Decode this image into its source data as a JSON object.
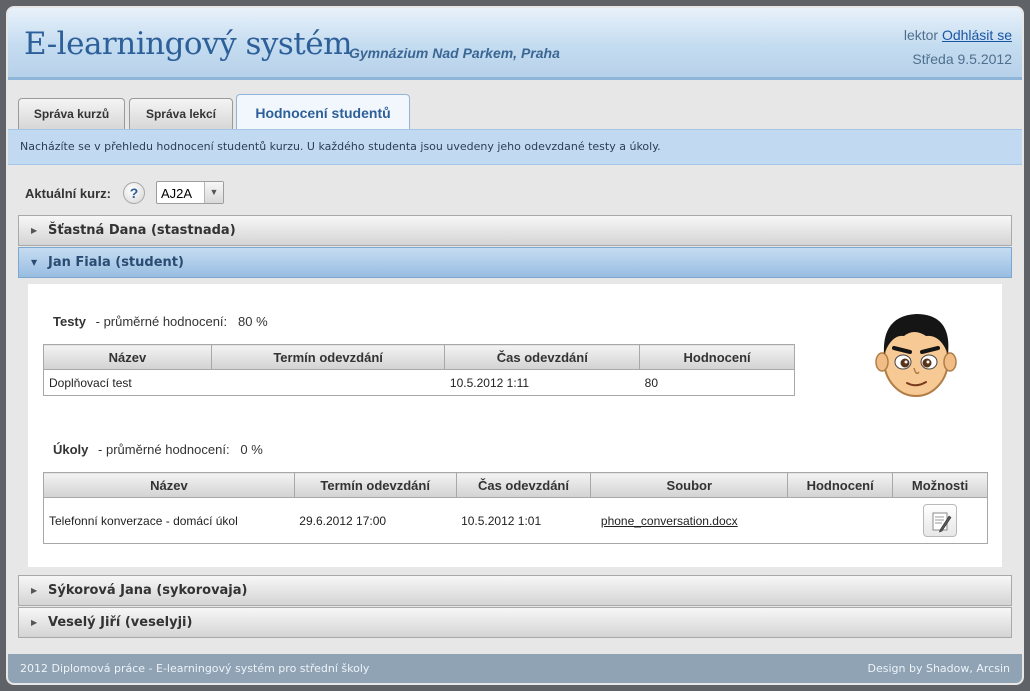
{
  "header": {
    "app_title": "E-learningový systém",
    "school": "Gymnázium Nad Parkem, Praha",
    "user_role": "lektor",
    "logout": "Odhlásit se",
    "date": "Středa 9.5.2012"
  },
  "tabs": [
    {
      "label": "Správa kurzů",
      "active": false
    },
    {
      "label": "Správa lekcí",
      "active": false
    },
    {
      "label": "Hodnocení studentů",
      "active": true
    }
  ],
  "info": "Nacházíte se v přehledu hodnocení studentů kurzu. U každého studenta jsou uvedeny jeho odevzdané testy a úkoly.",
  "course": {
    "label": "Aktuální kurz:",
    "help_icon": "question-icon",
    "selected": "AJ2A"
  },
  "students": [
    {
      "name": "Šťastná Dana (stastnada)",
      "expanded": false
    },
    {
      "name": "Jan Fiala (student)",
      "expanded": true
    },
    {
      "name": "Sýkorová Jana (sykorovaja)",
      "expanded": false
    },
    {
      "name": "Veselý Jiří (veselyji)",
      "expanded": false
    }
  ],
  "detail": {
    "tests": {
      "title": "Testy",
      "avg_label": "- průměrné hodnocení:",
      "avg_value": "80 %",
      "columns": [
        "Název",
        "Termín odevzdání",
        "Čas odevzdání",
        "Hodnocení"
      ],
      "rows": [
        [
          "Doplňovací test",
          "",
          "10.5.2012 1:11",
          "80"
        ]
      ]
    },
    "tasks": {
      "title": "Úkoly",
      "avg_label": "- průměrné hodnocení:",
      "avg_value": "0 %",
      "columns": [
        "Název",
        "Termín odevzdání",
        "Čas odevzdání",
        "Soubor",
        "Hodnocení",
        "Možnosti"
      ],
      "rows": [
        [
          "Telefonní konverzace - domácí úkol",
          "29.6.2012 17:00",
          "10.5.2012 1:01",
          "phone_conversation.docx",
          ""
        ]
      ],
      "option_icon": "edit-grade-icon"
    }
  },
  "footer": {
    "left": "2012 Diplomová práce - E-learningový systém pro střední školy",
    "right": "Design by Shadow, Arcsin"
  },
  "colors": {
    "accent": "#2d5f99",
    "info_bar": "#c1d9f1",
    "footer": "#8fa3b5"
  }
}
